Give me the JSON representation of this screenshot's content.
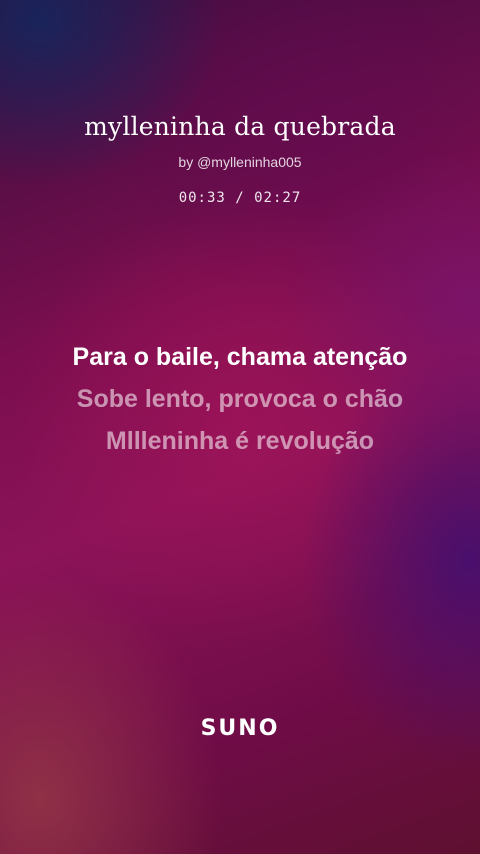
{
  "song": {
    "title": "mylleninha da quebrada",
    "byline": "by @mylleninha005",
    "time": "00:33 / 02:27"
  },
  "lyrics": {
    "lines": [
      "Para o baile, chama atenção",
      "Sobe lento, provoca o chão",
      "Mllleninha é revolução"
    ]
  },
  "brand": {
    "logo_text": "SUNO"
  },
  "colors": {
    "text": "#ffffff",
    "background_primary": "#7a0e4e"
  }
}
